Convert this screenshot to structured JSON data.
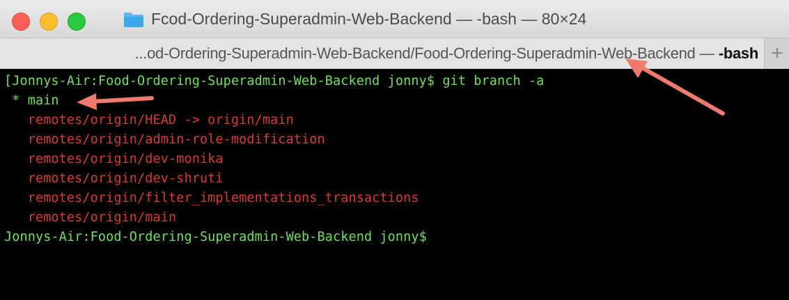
{
  "window": {
    "title": "Fcod-Ordering-Superadmin-Web-Backend — -bash — 80×24"
  },
  "tab": {
    "title_prefix": "...od-Ordering-Superadmin-Web-Backend/Food-Ordering-Superadmin-Web-Backend — ",
    "title_suffix": "-bash",
    "new_tab_label": "+"
  },
  "terminal": {
    "command_line": "[Jonnys-Air:Food-Ordering-Superadmin-Web-Backend jonny$ git branch -a",
    "current_branch": " * main",
    "remote_branches": [
      "   remotes/origin/HEAD -> origin/main",
      "   remotes/origin/admin-role-modification",
      "   remotes/origin/dev-monika",
      "   remotes/origin/dev-shruti",
      "   remotes/origin/filter_implementations_transactions",
      "   remotes/origin/main"
    ],
    "prompt": "Jonnys-Air:Food-Ordering-Superadmin-Web-Backend jonny$"
  },
  "colors": {
    "terminal_background": "#000000",
    "prompt_green": "#6ee05a",
    "remote_red": "#d83a2e",
    "annotation_arrow": "#f07a6e"
  },
  "icons": [
    "close-icon",
    "minimize-icon",
    "zoom-icon",
    "folder-icon",
    "plus-icon"
  ]
}
